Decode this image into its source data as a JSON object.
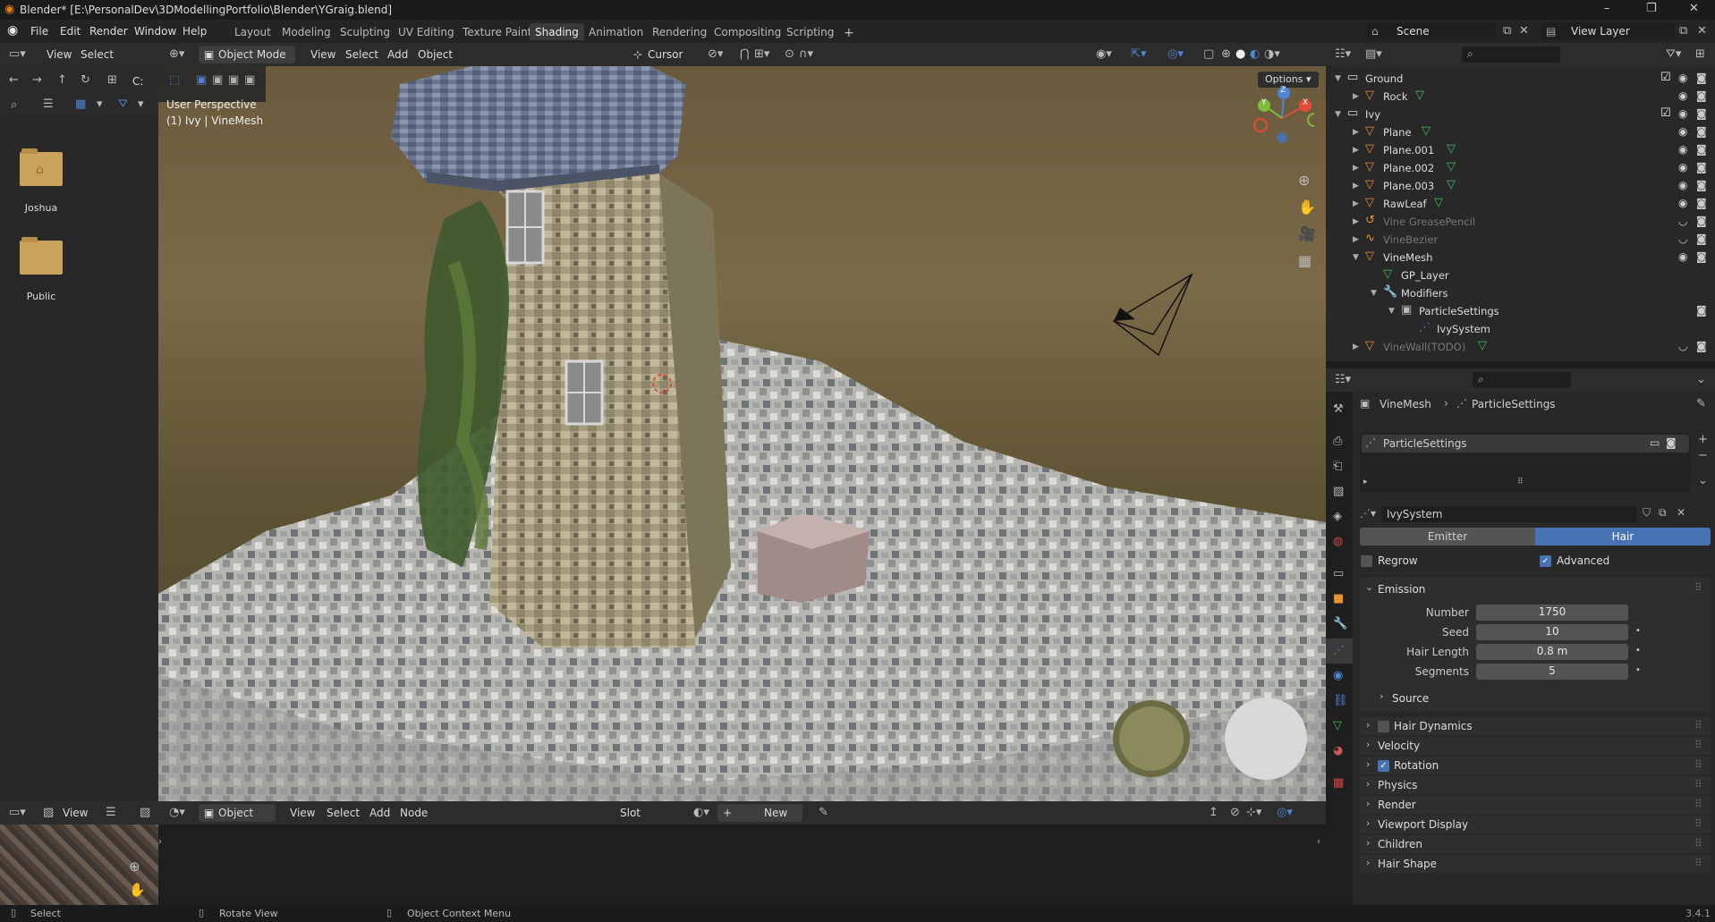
{
  "window": {
    "title": "Blender* [E:\\PersonalDev\\3DModellingPortfolio\\Blender\\YGraig.blend]",
    "min": "–",
    "max": "❐",
    "close": "✕"
  },
  "menu": {
    "items": [
      "File",
      "Edit",
      "Render",
      "Window",
      "Help"
    ]
  },
  "workspaces": {
    "tabs": [
      "Layout",
      "Modeling",
      "Sculpting",
      "UV Editing",
      "Texture Paint",
      "Shading",
      "Animation",
      "Rendering",
      "Compositing",
      "Scripting"
    ],
    "active": "Shading",
    "add": "+"
  },
  "scene": {
    "name": "Scene",
    "view_layer": "View Layer"
  },
  "filebrowser": {
    "menu": [
      "View",
      "Select"
    ],
    "path": "C:",
    "items": [
      {
        "label": "Joshua"
      },
      {
        "label": "Public"
      }
    ]
  },
  "viewport": {
    "mode": "Object Mode",
    "menu": [
      "View",
      "Select",
      "Add",
      "Object"
    ],
    "pivot": "Cursor",
    "options": "Options",
    "overlay_line1": "User Perspective",
    "overlay_line2": "(1) Ivy | VineMesh",
    "gizmo": {
      "x": "X",
      "y": "Y",
      "z": "Z"
    }
  },
  "outliner": {
    "rows": [
      {
        "label": "Ground",
        "indent": 0,
        "type": "collection",
        "expanded": true
      },
      {
        "label": "Rock",
        "indent": 1,
        "type": "mesh"
      },
      {
        "label": "Ivy",
        "indent": 0,
        "type": "collection",
        "expanded": true
      },
      {
        "label": "Plane",
        "indent": 1,
        "type": "mesh"
      },
      {
        "label": "Plane.001",
        "indent": 1,
        "type": "mesh"
      },
      {
        "label": "Plane.002",
        "indent": 1,
        "type": "mesh"
      },
      {
        "label": "Plane.003",
        "indent": 1,
        "type": "mesh"
      },
      {
        "label": "RawLeaf",
        "indent": 1,
        "type": "mesh"
      },
      {
        "label": "Vine GreasePencil",
        "indent": 1,
        "type": "gp",
        "dim": true
      },
      {
        "label": "VineBezier",
        "indent": 1,
        "type": "curve",
        "dim": true
      },
      {
        "label": "VineMesh",
        "indent": 1,
        "type": "mesh",
        "expanded": true
      },
      {
        "label": "GP_Layer",
        "indent": 2,
        "type": "data"
      },
      {
        "label": "Modifiers",
        "indent": 2,
        "type": "mod",
        "expanded": true
      },
      {
        "label": "ParticleSettings",
        "indent": 3,
        "type": "particles",
        "expanded": true
      },
      {
        "label": "IvySystem",
        "indent": 4,
        "type": "psys"
      },
      {
        "label": "VineWall(TODO)",
        "indent": 1,
        "type": "mesh",
        "dim": true
      }
    ]
  },
  "properties": {
    "breadcrumb": [
      "VineMesh",
      "ParticleSettings"
    ],
    "slot": "ParticleSettings",
    "system_name": "IvySystem",
    "type_tabs": [
      "Emitter",
      "Hair"
    ],
    "type_active": "Hair",
    "regrow": "Regrow",
    "advanced": "Advanced",
    "emission": {
      "title": "Emission",
      "fields": [
        {
          "label": "Number",
          "value": "1750"
        },
        {
          "label": "Seed",
          "value": "10"
        },
        {
          "label": "Hair Length",
          "value": "0.8 m"
        },
        {
          "label": "Segments",
          "value": "5"
        }
      ],
      "source": "Source"
    },
    "panels": [
      "Hair Dynamics",
      "Velocity",
      "Rotation",
      "Physics",
      "Render",
      "Viewport Display",
      "Children",
      "Hair Shape"
    ]
  },
  "node_editor": {
    "mode": "Object",
    "menu": [
      "View",
      "Select",
      "Add",
      "Node"
    ],
    "slot": "Slot",
    "new": "New"
  },
  "image_editor": {
    "menu": "View"
  },
  "statusbar": {
    "items": [
      "Select",
      "Rotate View",
      "Object Context Menu"
    ],
    "version": "3.4.1"
  }
}
